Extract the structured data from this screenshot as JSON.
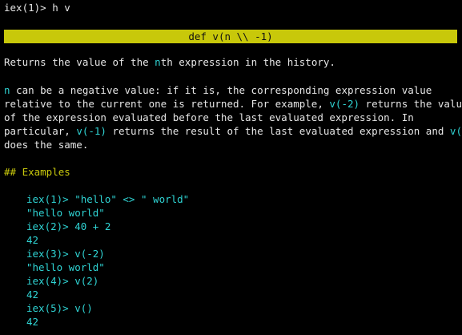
{
  "terminal": {
    "prompt_line": "iex(1)> h v",
    "banner": "def v(n \\\\ -1)",
    "description": {
      "p1": {
        "pre": "Returns the value of the ",
        "code": "n",
        "post": "th expression in the history."
      },
      "p2": {
        "l1_code": "n",
        "l1_text": " can be a negative value: if it is, the corresponding expression value",
        "l2_text": "relative to the current one is returned. For example, ",
        "l2_code": "v(-2)",
        "l2_post": " returns the value",
        "l3_text": "of the expression evaluated before the last evaluated expression. In",
        "l4_pre": "particular, ",
        "l4_code1": "v(-1)",
        "l4_mid": " returns the result of the last evaluated expression and ",
        "l4_code2": "v()",
        "l5_text": "does the same."
      }
    },
    "examples_heading": "## Examples",
    "examples": [
      "iex(1)> \"hello\" <> \" world\"",
      "\"hello world\"",
      "iex(2)> 40 + 2",
      "42",
      "iex(3)> v(-2)",
      "\"hello world\"",
      "iex(4)> v(2)",
      "42",
      "iex(5)> v()",
      "42"
    ]
  },
  "colors": {
    "background": "#000000",
    "text": "#e6e6e6",
    "code": "#2fd3d3",
    "heading": "#c9c90c",
    "banner_bg": "#c8c80a"
  }
}
